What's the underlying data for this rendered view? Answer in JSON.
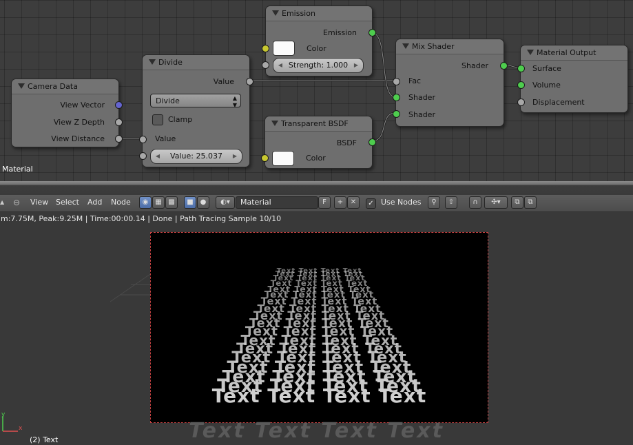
{
  "node_editor": {
    "label": "Material",
    "nodes": {
      "camera_data": {
        "title": "Camera Data",
        "outputs": [
          "View Vector",
          "View Z Depth",
          "View Distance"
        ]
      },
      "divide": {
        "title": "Divide",
        "output": "Value",
        "operation": "Divide",
        "clamp_label": "Clamp",
        "clamp_checked": false,
        "input_label": "Value",
        "value_field": "Value: 25.037"
      },
      "emission": {
        "title": "Emission",
        "output": "Emission",
        "color_label": "Color",
        "color": "#fbfbfb",
        "strength_field": "Strength: 1.000"
      },
      "transparent_bsdf": {
        "title": "Transparent BSDF",
        "output": "BSDF",
        "color_label": "Color",
        "color": "#fbfbfb"
      },
      "mix_shader": {
        "title": "Mix Shader",
        "output": "Shader",
        "inputs": [
          "Fac",
          "Shader",
          "Shader"
        ]
      },
      "material_output": {
        "title": "Material Output",
        "inputs": [
          "Surface",
          "Volume",
          "Displacement"
        ]
      }
    }
  },
  "header": {
    "menus": [
      "View",
      "Select",
      "Add",
      "Node"
    ],
    "shader_type_icons": [
      "object-shader-icon",
      "world-shader-icon",
      "texture-icon"
    ],
    "material_name": "Material",
    "fake_user_label": "F",
    "use_nodes_label": "Use Nodes",
    "use_nodes_checked": true
  },
  "status": {
    "text": "m:7.75M, Peak:9.25M | Time:00:00.14 | Done | Path Tracing Sample 10/10"
  },
  "viewport": {
    "render_text_rows": [
      "Text Text Text Text",
      "Text Text Text Text",
      "Text Text Text Text",
      "Text Text Text Text",
      "Text Text Text Text",
      "Text Text Text Text",
      "Text Text Text Text",
      "Text Text Text Text",
      "Text Text Text Text",
      "Text Text Text Text",
      "Text Text Text Text",
      "Text Text Text Text",
      "Text Text Text Text",
      "Text Text Text Text",
      "Text Text Text Text",
      "Text Text Text Text",
      "Text Text Text Text",
      "Text Text Text Text"
    ],
    "ground_text": "Text Text Text Text",
    "object_label": "(2) Text",
    "axis_labels": {
      "y": "y",
      "x": "x"
    },
    "colors": {
      "render_border": "#c04040",
      "text": "#cfcfcf"
    }
  }
}
